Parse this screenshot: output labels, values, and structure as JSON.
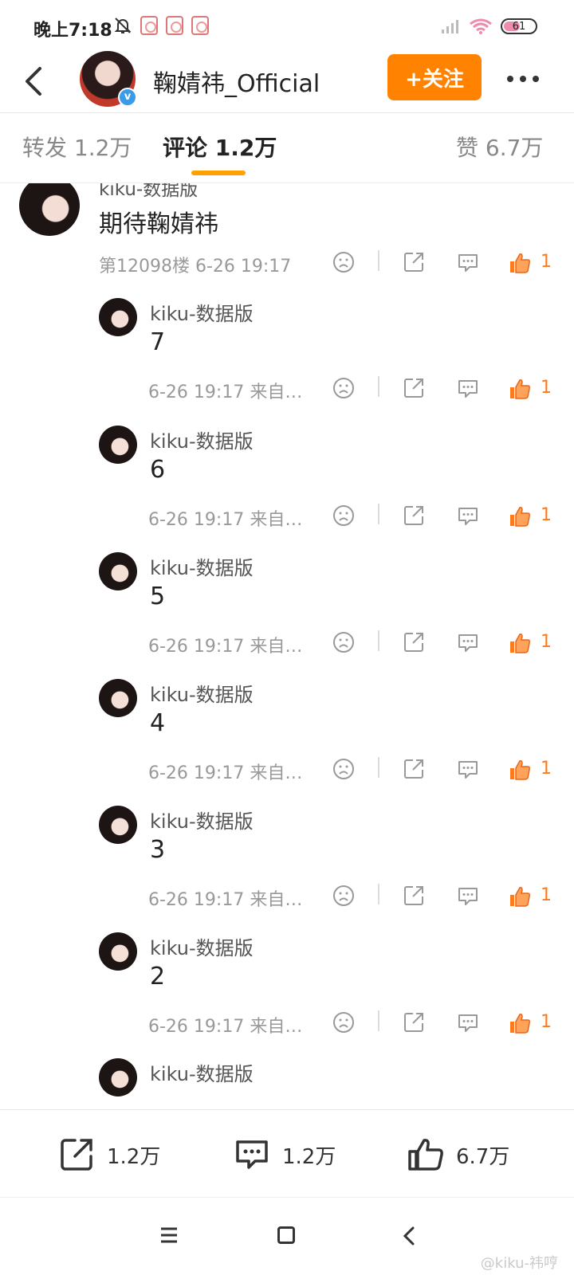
{
  "status": {
    "time": "晚上7:18",
    "battery": "61"
  },
  "header": {
    "name": "鞠婧祎_Official",
    "follow_label": "+关注"
  },
  "tabs": [
    {
      "label": "转发 1.2万"
    },
    {
      "label": "评论 1.2万"
    },
    {
      "label": "赞 6.7万"
    }
  ],
  "main_comment": {
    "user": "kiku-数据版",
    "text": "期待鞠婧祎",
    "meta": "第12098楼 6-26 19:17",
    "likes": "1"
  },
  "replies": [
    {
      "user": "kiku-数据版",
      "text": "7",
      "meta": "6-26 19:17 来自…",
      "likes": "1"
    },
    {
      "user": "kiku-数据版",
      "text": "6",
      "meta": "6-26 19:17 来自…",
      "likes": "1"
    },
    {
      "user": "kiku-数据版",
      "text": "5",
      "meta": "6-26 19:17 来自…",
      "likes": "1"
    },
    {
      "user": "kiku-数据版",
      "text": "4",
      "meta": "6-26 19:17 来自…",
      "likes": "1"
    },
    {
      "user": "kiku-数据版",
      "text": "3",
      "meta": "6-26 19:17 来自…",
      "likes": "1"
    },
    {
      "user": "kiku-数据版",
      "text": "2",
      "meta": "6-26 19:17 来自…",
      "likes": "1"
    },
    {
      "user": "kiku-数据版"
    }
  ],
  "bottom_bar": {
    "reposts": "1.2万",
    "comments": "1.2万",
    "likes": "6.7万"
  },
  "watermark": "@kiku-祎哼",
  "colors": {
    "accent_orange": "#ff8200",
    "tab_underline": "#ffa100",
    "like_orange": "#ff7a1a",
    "verified_blue": "#3a9ce8"
  }
}
